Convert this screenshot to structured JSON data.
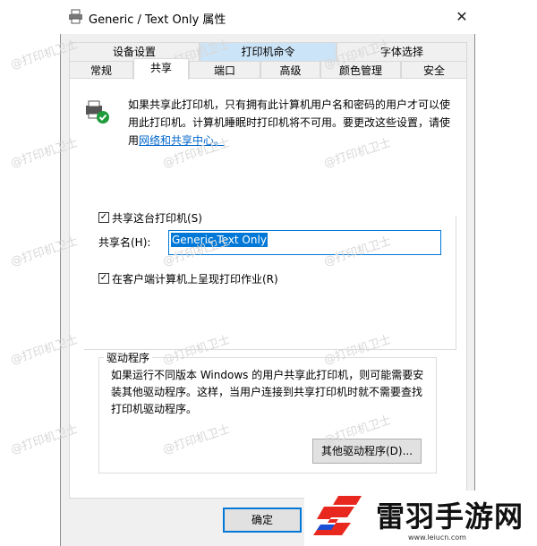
{
  "window": {
    "title": "Generic / Text Only 属性",
    "close_symbol": "✕"
  },
  "tabs_row1": [
    {
      "label": "设备设置"
    },
    {
      "label": "打印机命令"
    },
    {
      "label": "字体选择"
    }
  ],
  "tabs_row2": [
    {
      "label": "常规"
    },
    {
      "label": "共享"
    },
    {
      "label": "端口"
    },
    {
      "label": "高级"
    },
    {
      "label": "颜色管理"
    },
    {
      "label": "安全"
    }
  ],
  "active_tab": "共享",
  "info": {
    "text": "如果共享此打印机，只有拥有此计算机用户名和密码的用户才可以使用此打印机。计算机睡眠时打印机将不可用。要更改这些设置，请使用",
    "link": "网络和共享中心。"
  },
  "share": {
    "checkbox_label": "共享这台打印机(S)",
    "checked": true,
    "name_label": "共享名(H):",
    "name_value": "Generic  Text Only"
  },
  "render_jobs": {
    "label": "在客户端计算机上呈现打印作业(R)",
    "checked": true
  },
  "drivers": {
    "group_title": "驱动程序",
    "text": "如果运行不同版本 Windows 的用户共享此打印机，则可能需要安装其他驱动程序。这样，当用户连接到共享打印机时就不需要查找打印机驱动程序。",
    "button_label": "其他驱动程序(D)..."
  },
  "footer": {
    "ok_label": "确定"
  },
  "watermark_text": "@打印机卫士",
  "branding": {
    "name": "雷羽手游网",
    "url": "www.leiucn.com",
    "accent": "#e8281e"
  }
}
